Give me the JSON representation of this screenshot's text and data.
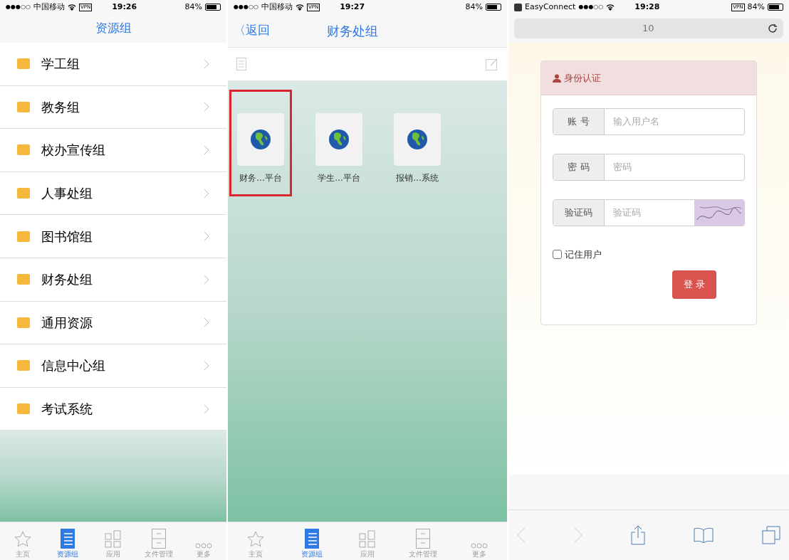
{
  "resource_screen": {
    "status": {
      "signal": "●●●○○",
      "carrier": "中国移动",
      "vpn": "VPN",
      "time": "19:26",
      "battery": "84%"
    },
    "title": "资源组",
    "items": [
      {
        "label": "学工组"
      },
      {
        "label": "教务组"
      },
      {
        "label": "校办宣传组"
      },
      {
        "label": "人事处组"
      },
      {
        "label": "图书馆组"
      },
      {
        "label": "财务处组"
      },
      {
        "label": "通用资源"
      },
      {
        "label": "信息中心组"
      },
      {
        "label": "考试系统"
      }
    ],
    "tabs": [
      {
        "kind": "star",
        "label": "主页",
        "selected": false
      },
      {
        "kind": "list",
        "label": "资源组",
        "selected": true
      },
      {
        "kind": "grid",
        "label": "应用",
        "selected": false
      },
      {
        "kind": "file",
        "label": "文件管理",
        "selected": false
      },
      {
        "kind": "more",
        "label": "更多",
        "selected": false
      }
    ]
  },
  "group_screen": {
    "status": {
      "signal": "●●●○○",
      "carrier": "中国移动",
      "vpn": "VPN",
      "time": "19:27",
      "battery": "84%"
    },
    "back": "〈返回",
    "title": "财务处组",
    "apps": [
      {
        "label": "财务...平台",
        "highlighted": true
      },
      {
        "label": "学生...平台",
        "highlighted": false
      },
      {
        "label": "报销...系统",
        "highlighted": false
      }
    ],
    "tabs": [
      {
        "kind": "star",
        "label": "主页",
        "selected": false
      },
      {
        "kind": "list",
        "label": "资源组",
        "selected": true
      },
      {
        "kind": "grid",
        "label": "应用",
        "selected": false
      },
      {
        "kind": "file",
        "label": "文件管理",
        "selected": false
      },
      {
        "kind": "more",
        "label": "更多",
        "selected": false
      }
    ]
  },
  "browser_screen": {
    "status": {
      "app": "EasyConnect",
      "signal": "●●●○○",
      "time": "19:28",
      "vpn": "VPN",
      "battery": "84%"
    },
    "url": "10",
    "login": {
      "title": "身份认证",
      "fields": [
        {
          "label": "账 号",
          "placeholder": "输入用户名",
          "kind": "text"
        },
        {
          "label": "密 码",
          "placeholder": "密码",
          "kind": "text"
        },
        {
          "label": "验证码",
          "placeholder": "验证码",
          "kind": "captcha"
        }
      ],
      "remember": {
        "label": "记住用户",
        "checked": false
      },
      "submit": "登 录"
    }
  }
}
